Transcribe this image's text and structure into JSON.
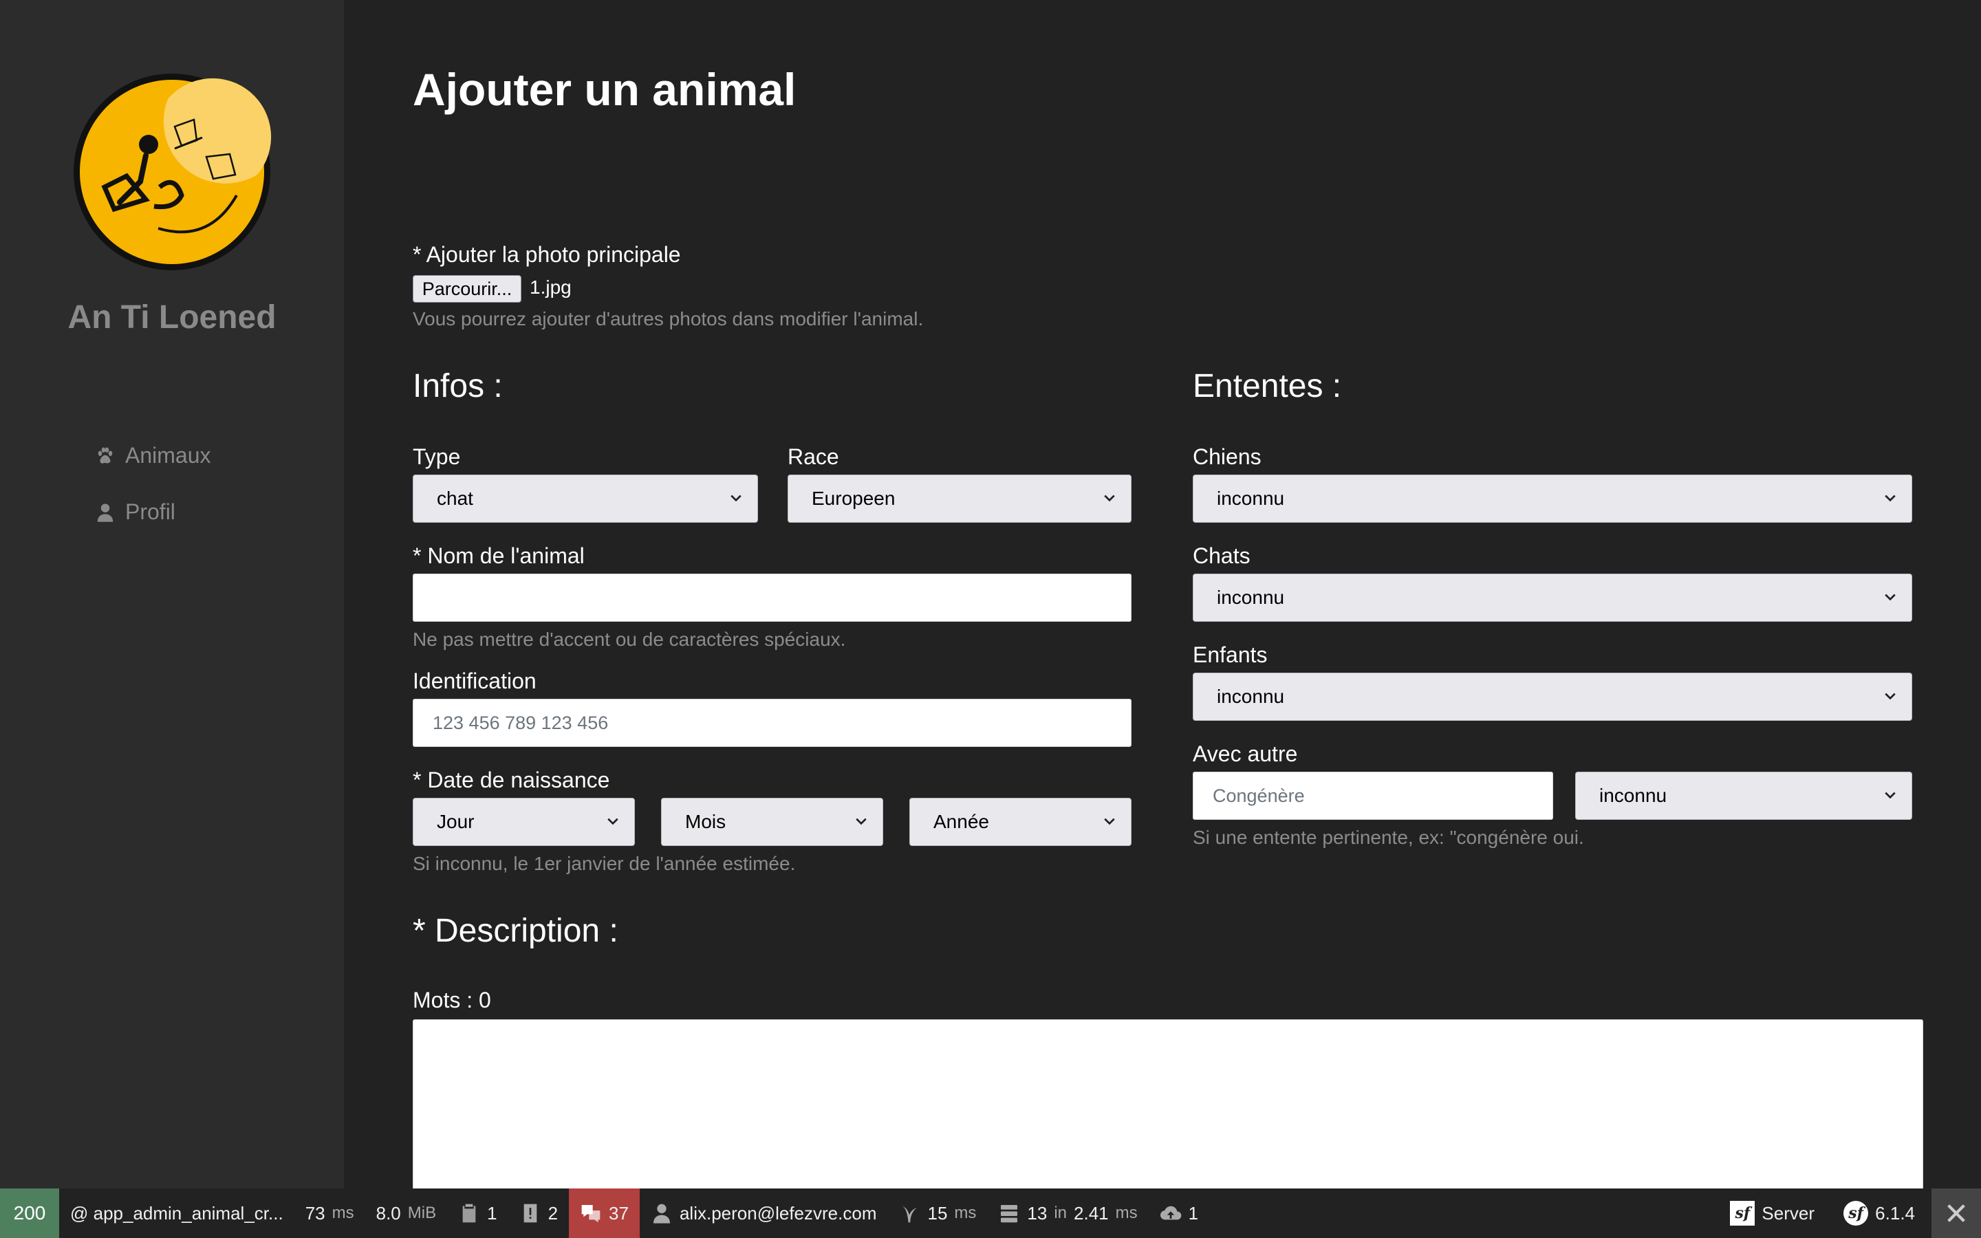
{
  "sidebar": {
    "brand": "An Ti Loened",
    "items": [
      {
        "label": "Animaux",
        "icon": "paw-icon"
      },
      {
        "label": "Profil",
        "icon": "user-icon"
      }
    ]
  },
  "page": {
    "title": "Ajouter un animal"
  },
  "photo": {
    "label": "* Ajouter la photo principale",
    "browse_label": "Parcourir...",
    "file_name": "1.jpg",
    "help": "Vous pourrez ajouter d'autres photos dans modifier l'animal."
  },
  "infos": {
    "title": "Infos :",
    "type_label": "Type",
    "type_value": "chat",
    "race_label": "Race",
    "race_value": "Europeen",
    "name_label": "* Nom de l'animal",
    "name_value": "",
    "name_help": "Ne pas mettre d'accent ou de caractères spéciaux.",
    "id_label": "Identification",
    "id_placeholder": "123 456 789 123 456",
    "birth_label": "* Date de naissance",
    "day_value": "Jour",
    "month_value": "Mois",
    "year_value": "Année",
    "birth_help": "Si inconnu, le 1er janvier de l'année estimée."
  },
  "ententes": {
    "title": "Ententes :",
    "dogs_label": "Chiens",
    "dogs_value": "inconnu",
    "cats_label": "Chats",
    "cats_value": "inconnu",
    "kids_label": "Enfants",
    "kids_value": "inconnu",
    "other_label": "Avec autre",
    "other_placeholder": "Congénère",
    "other_value": "inconnu",
    "other_help": "Si une entente pertinente, ex: \"congénère oui."
  },
  "description": {
    "title": "* Description :",
    "word_count": "Mots : 0"
  },
  "toolbar": {
    "status": "200",
    "route": "@ app_admin_animal_cr...",
    "time_value": "73",
    "time_unit": "ms",
    "memory_value": "8.0",
    "memory_unit": "MiB",
    "logs_count": "1",
    "warnings_count": "2",
    "translations_count": "37",
    "user": "alix.peron@lefezvre.com",
    "twig_value": "15",
    "twig_unit": "ms",
    "db_queries": "13",
    "db_in": "in",
    "db_time": "2.41",
    "db_unit": "ms",
    "uploads_count": "1",
    "server_label": "Server",
    "symfony_version": "6.1.4",
    "colors": {
      "status_ok": "#4f805d",
      "alert": "#b0413e"
    }
  }
}
